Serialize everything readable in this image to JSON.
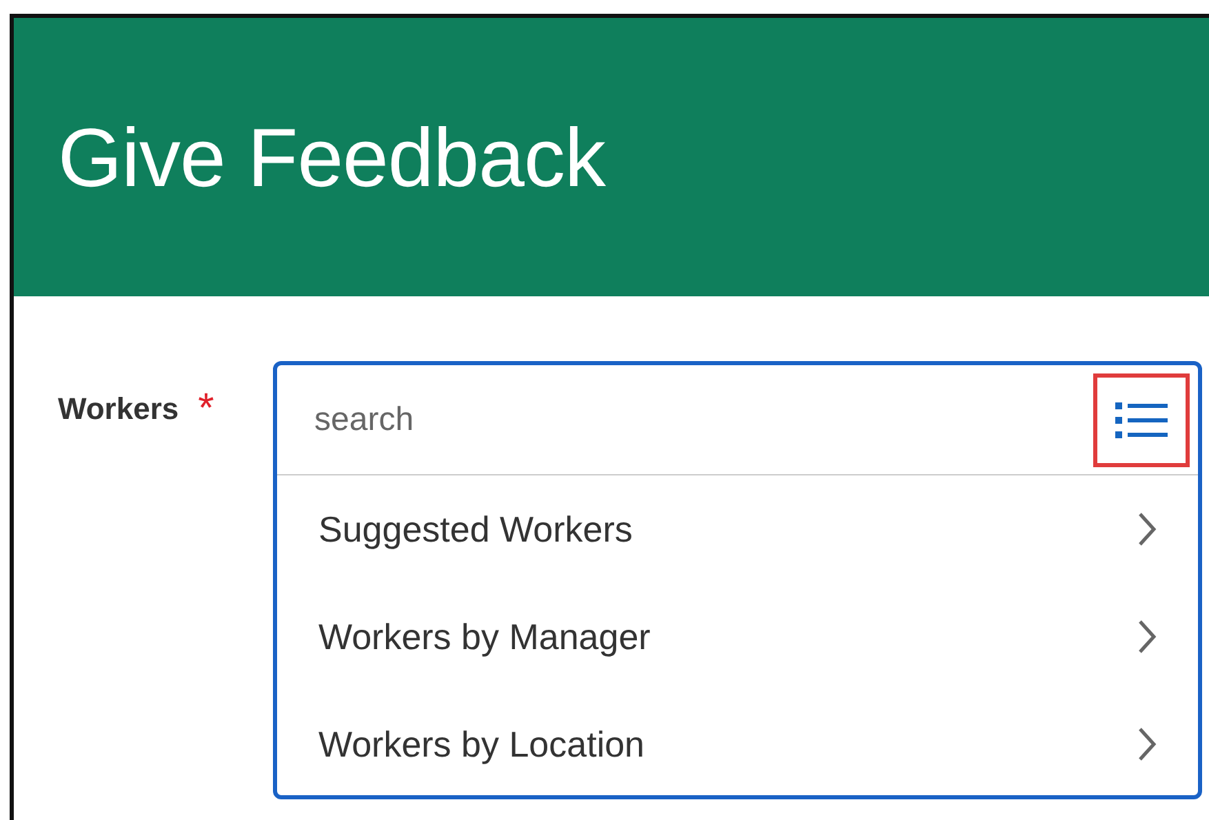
{
  "header": {
    "title": "Give Feedback"
  },
  "field": {
    "label": "Workers",
    "required_mark": "*",
    "placeholder": "search",
    "list_button": {
      "highlighted": true
    }
  },
  "options": [
    {
      "label": "Suggested Workers"
    },
    {
      "label": "Workers by Manager"
    },
    {
      "label": "Workers by Location"
    }
  ]
}
